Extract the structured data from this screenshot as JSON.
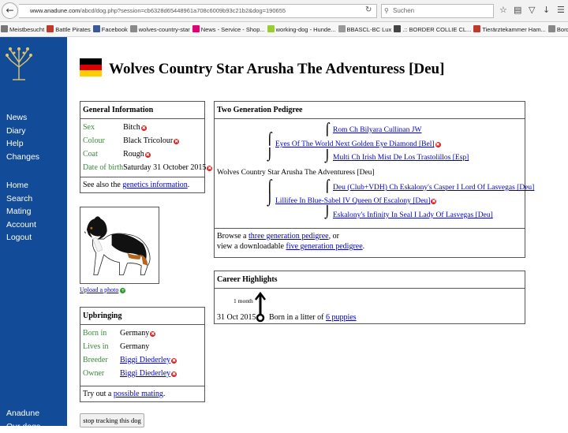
{
  "browser": {
    "url_host": "www.anadune.com",
    "url_rest": "/abcd/dog.php?session=cb6328d65448961a708c6009b93c21b2&dog=190655",
    "search_placeholder": "Suchen",
    "bookmarks": [
      {
        "label": "Meistbesucht",
        "color": "#777777"
      },
      {
        "label": "Battle Pirates",
        "color": "#c0392b"
      },
      {
        "label": "Facebook",
        "color": "#3b5998"
      },
      {
        "label": "wolves-country-star",
        "color": "#8a8a8a"
      },
      {
        "label": "News - Service - Shop...",
        "color": "#e20074"
      },
      {
        "label": "working-dog - Hunde...",
        "color": "#9acd32"
      },
      {
        "label": "BBASCL-BC Lux",
        "color": "#999999"
      },
      {
        "label": ".:: BORDER COLLIE CL...",
        "color": "#444444"
      },
      {
        "label": "Tierärztekammer Ham...",
        "color": "#c0392b"
      },
      {
        "label": "Border Collie Epilepsy...",
        "color": "#888888"
      }
    ]
  },
  "sidebar": {
    "group1": [
      "News",
      "Diary",
      "Help",
      "Changes"
    ],
    "group2": [
      "Home",
      "Search",
      "Mating",
      "Account",
      "Logout"
    ],
    "group3": [
      "Anadune",
      "Our dogs"
    ],
    "colors": {
      "bg": "#124b97",
      "text": "#ffffff"
    }
  },
  "page": {
    "title": "Wolves Country Star Arusha The Adventuress [Deu]",
    "flag_colors": [
      "#000000",
      "#dd0000",
      "#ffce00"
    ]
  },
  "general": {
    "heading": "General Information",
    "rows": [
      {
        "key": "Sex",
        "value": "Bitch"
      },
      {
        "key": "Colour",
        "value": "Black Tricolour"
      },
      {
        "key": "Coat",
        "value": "Rough"
      },
      {
        "key": "Date of birth",
        "value": "Saturday 31 October 2015"
      }
    ],
    "footer_prefix": "See also the ",
    "footer_link": "genetics information",
    "footer_suffix": "."
  },
  "photo": {
    "upload_label": "Upload a photo"
  },
  "upbringing": {
    "heading": "Upbringing",
    "rows": [
      {
        "key": "Born in",
        "value": "Germany"
      },
      {
        "key": "Lives in",
        "value": "Germany"
      },
      {
        "key": "Breeder",
        "value": "Biggi Diederley"
      },
      {
        "key": "Owner",
        "value": "Biggi Diederley"
      }
    ],
    "footer_prefix": "Try out a ",
    "footer_link": "possible mating",
    "footer_suffix": "."
  },
  "pedigree": {
    "heading": "Two Generation Pedigree",
    "subject": "Wolves Country Star Arusha The Adventuress [Deu]",
    "sire": "Eyes Of The World Next Golden Eye Diamond [Bel]",
    "sire_sire": "Rom Ch Bilyara Cullinan JW",
    "sire_dam": "Multi Ch Irish Mist De Los Trastolillos [Esp]",
    "dam": "Lillifee In Blue-Sabel IV Queen Of Escalony [Deu]",
    "dam_sire": "Deu (Club+VDH) Ch Eskalony's Casper I Lord Of Lasvegas [Deu]",
    "dam_dam": "Eskalony's Infinity In Seal I Lady Of Lasvegas [Deu]",
    "footer": {
      "line1_prefix": "Browse a ",
      "line1_link": "three generation pedigree",
      "line1_suffix": ", or",
      "line2_prefix": "view a downloadable ",
      "line2_link": "five generation pedigree",
      "line2_suffix": "."
    }
  },
  "career": {
    "heading": "Career Highlights",
    "duration": "1 month",
    "date": "31 Oct 2015",
    "event_prefix": "Born in a litter of ",
    "event_link": "6 puppies"
  },
  "buttons": {
    "stop_tracking": "stop tracking this dog"
  }
}
